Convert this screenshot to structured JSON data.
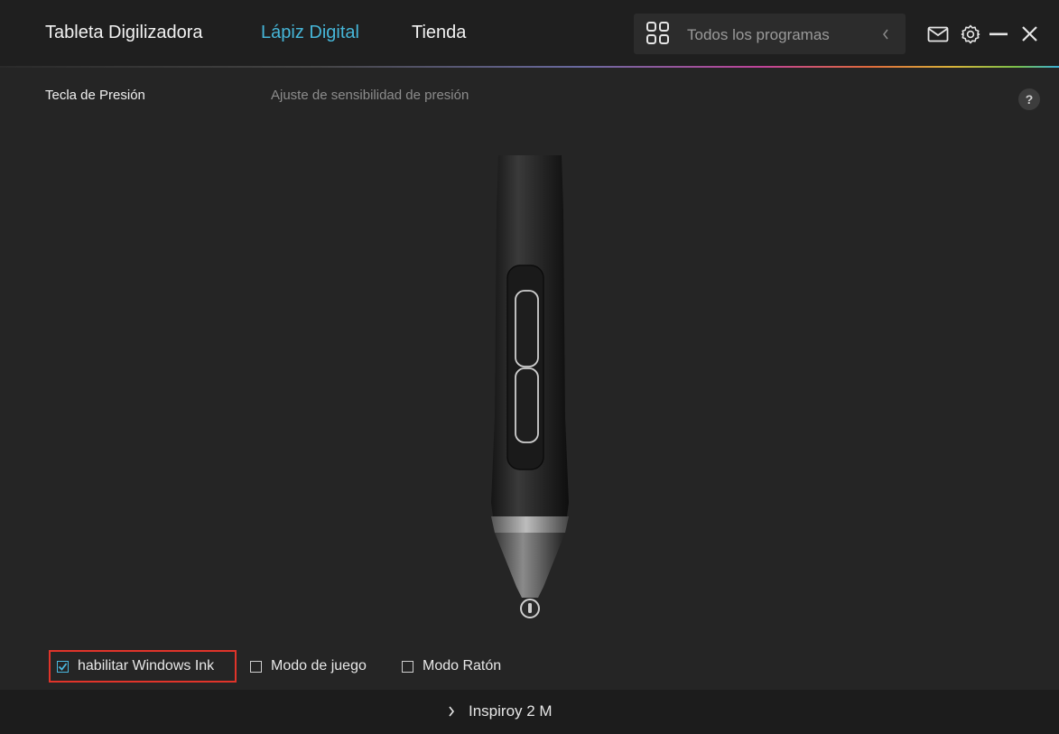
{
  "header": {
    "tabs": [
      {
        "label": "Tableta Digilizadora",
        "active": false
      },
      {
        "label": "Lápiz Digital",
        "active": true
      },
      {
        "label": "Tienda",
        "active": false
      }
    ],
    "program_selector": {
      "label": "Todos los programas",
      "icon": "grid-icon"
    },
    "icons": [
      "mail-icon",
      "gear-icon",
      "minimize-icon",
      "close-icon"
    ],
    "accent_color": "#46b6d8"
  },
  "subheader": {
    "left_label": "Tecla de Presión",
    "center_label": "Ajuste de sensibilidad de presión",
    "help_label": "?"
  },
  "options": [
    {
      "label": "habilitar Windows Ink",
      "checked": true
    },
    {
      "label": "Modo de juego",
      "checked": false
    },
    {
      "label": "Modo Ratón",
      "checked": false
    }
  ],
  "footer": {
    "device_name": "Inspiroy 2 M"
  }
}
